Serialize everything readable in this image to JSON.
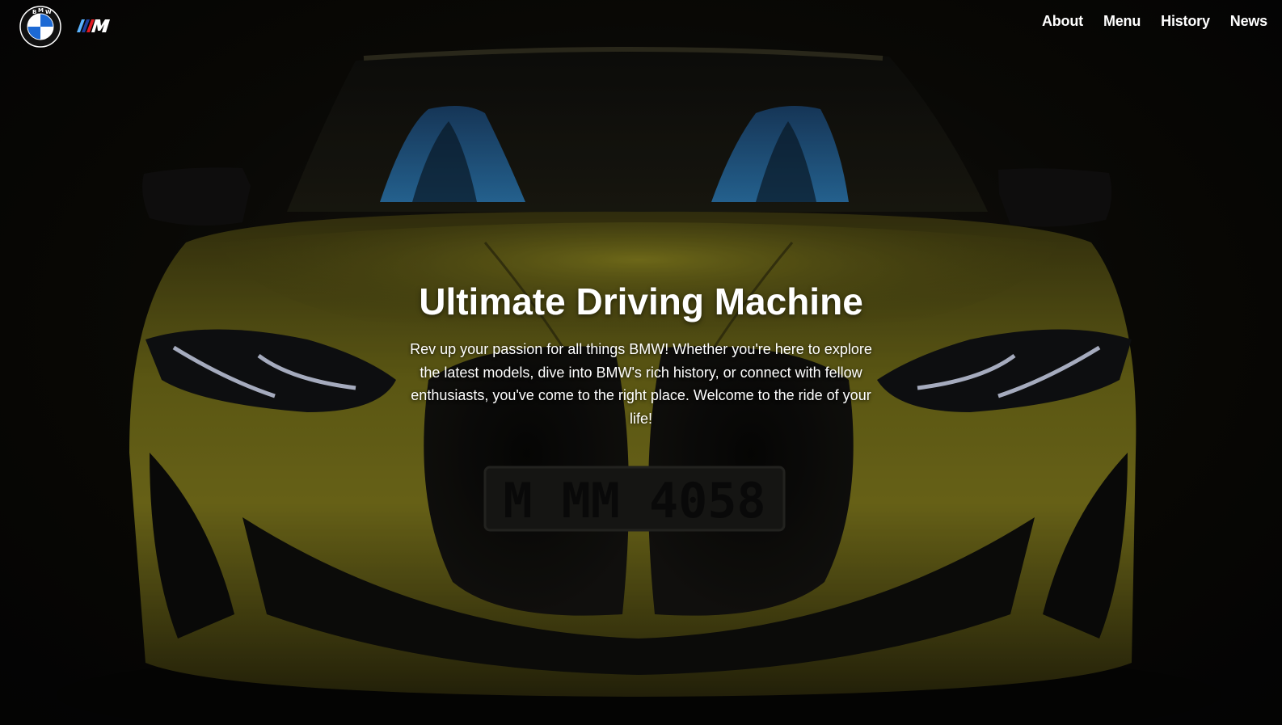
{
  "brand": {
    "logo_letters": "BMW",
    "logo_colors": {
      "blue": "#1c69d4",
      "white": "#ffffff",
      "ring": "#ffffff"
    },
    "m_stripes": [
      "#5bb4ff",
      "#1c3f9e",
      "#e31b23"
    ]
  },
  "nav": {
    "items": [
      {
        "label": "About"
      },
      {
        "label": "Menu"
      },
      {
        "label": "History"
      },
      {
        "label": "News"
      }
    ]
  },
  "hero": {
    "title": "Ultimate Driving Machine",
    "description": "Rev up your passion for all things BMW! Whether you're here to explore the latest models, dive into BMW's rich history, or connect with fellow enthusiasts, you've come to the right place. Welcome to the ride of your life!",
    "plate_text": "M MM 4058",
    "car_color": "#b3a81a"
  }
}
